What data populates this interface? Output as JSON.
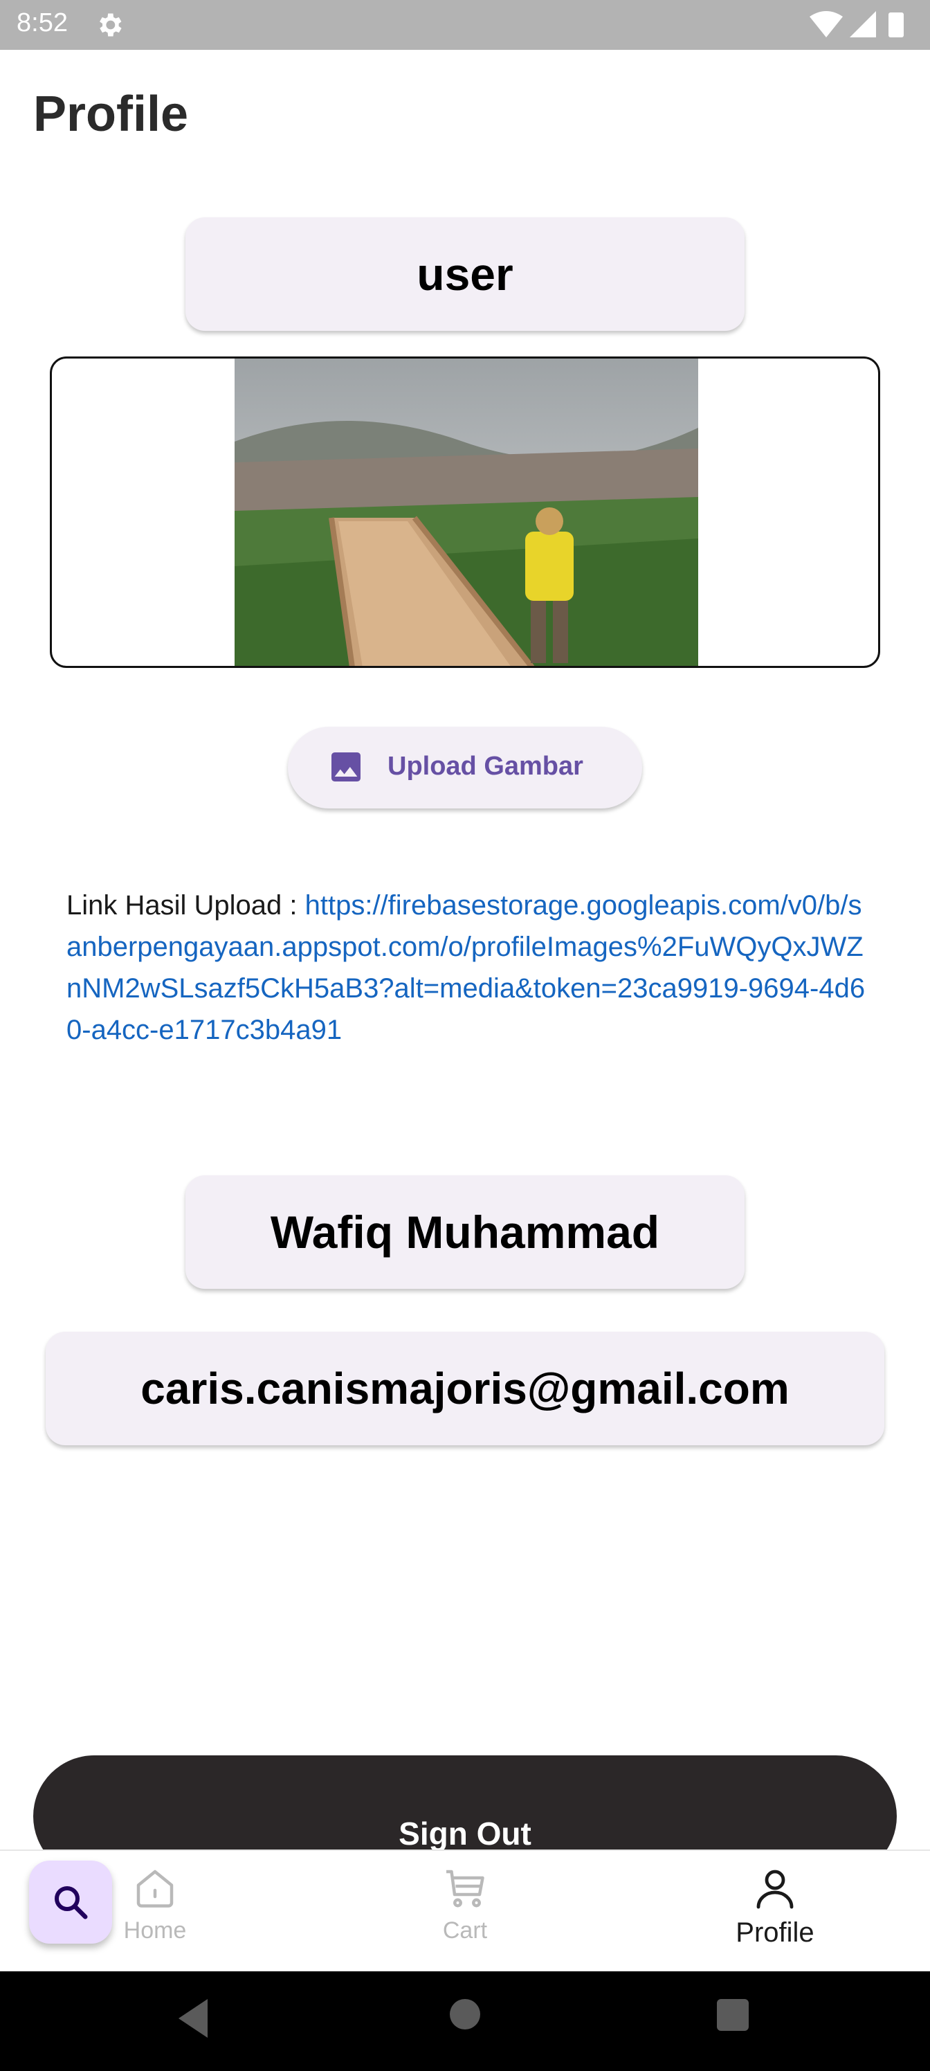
{
  "status_bar": {
    "time": "8:52",
    "icons": [
      "settings-gear-icon",
      "wifi-icon",
      "signal-icon",
      "battery-icon"
    ]
  },
  "page": {
    "title": "Profile"
  },
  "profile": {
    "username": "user",
    "photo_description_icon": "photo-image",
    "upload_button_label": "Upload Gambar",
    "link_label": "Link Hasil Upload : ",
    "link_url": "https://firebasestorage.googleapis.com/v0/b/sanberpengayaan.appspot.com/o/profileImages%2FuWQyQxJWZnNM2wSLsazf5CkH5aB3?alt=media&token=23ca9919-9694-4d60-a4cc-e1717c3b4a91",
    "full_name": "Wafiq Muhammad",
    "email": "caris.canismajoris@gmail.com",
    "sign_out_label": "Sign Out"
  },
  "bottom_nav": {
    "fab_icon": "search-icon",
    "items": [
      {
        "label": "Home",
        "icon": "home-icon",
        "active": false
      },
      {
        "label": "Cart",
        "icon": "cart-icon",
        "active": false
      },
      {
        "label": "Profile",
        "icon": "person-icon",
        "active": true
      }
    ]
  },
  "colors": {
    "pill_background": "#f3eff6",
    "accent_purple": "#6650a4",
    "link_blue": "#1565c0",
    "sign_out_background": "#2b2728",
    "fab_background": "#eadcff"
  }
}
